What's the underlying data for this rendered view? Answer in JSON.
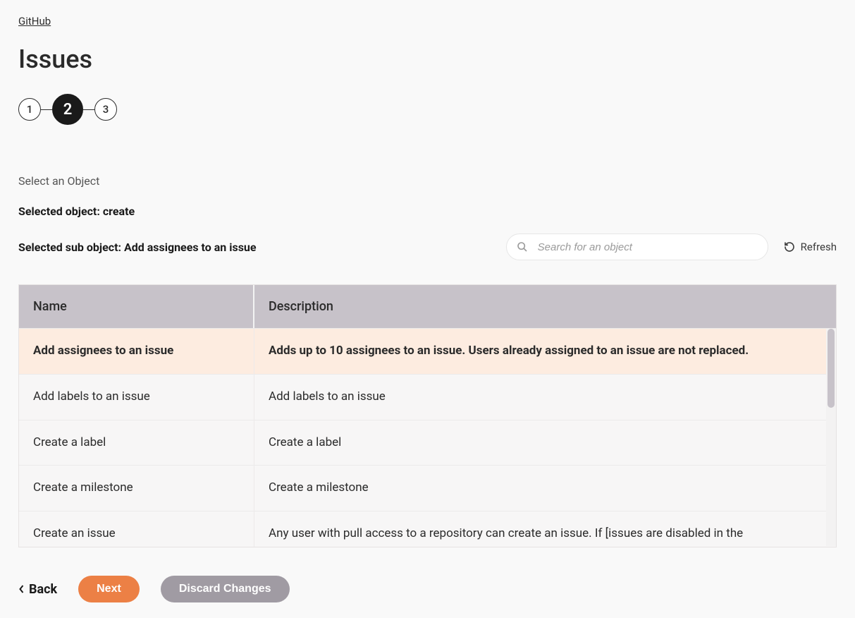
{
  "breadcrumb": {
    "label": "GitHub"
  },
  "page": {
    "title": "Issues"
  },
  "stepper": {
    "steps": [
      "1",
      "2",
      "3"
    ],
    "active_index": 1
  },
  "section": {
    "label": "Select an Object",
    "selected_object_prefix": "Selected object: ",
    "selected_object": "create",
    "selected_sub_prefix": "Selected sub object: ",
    "selected_sub": "Add assignees to an issue"
  },
  "search": {
    "placeholder": "Search for an object"
  },
  "refresh": {
    "label": "Refresh"
  },
  "table": {
    "headers": {
      "name": "Name",
      "description": "Description"
    },
    "rows": [
      {
        "name": "Add assignees to an issue",
        "description": "Adds up to 10 assignees to an issue. Users already assigned to an issue are not replaced.",
        "selected": true
      },
      {
        "name": "Add labels to an issue",
        "description": "Add labels to an issue",
        "selected": false
      },
      {
        "name": "Create a label",
        "description": "Create a label",
        "selected": false
      },
      {
        "name": "Create a milestone",
        "description": "Create a milestone",
        "selected": false
      },
      {
        "name": "Create an issue",
        "description": "Any user with pull access to a repository can create an issue. If [issues are disabled in the",
        "selected": false
      }
    ]
  },
  "footer": {
    "back": "Back",
    "next": "Next",
    "discard": "Discard Changes"
  }
}
